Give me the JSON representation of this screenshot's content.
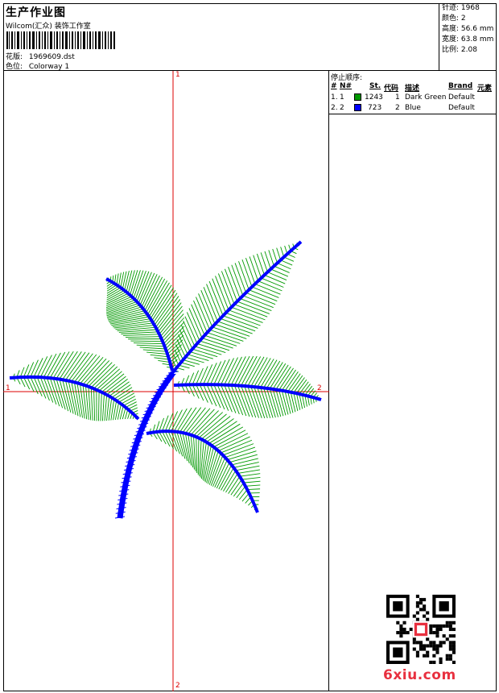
{
  "header": {
    "title": "生产作业图",
    "subtitle": "Wilcom(汇众) 装饰工作室",
    "design_label": "花版:",
    "design_value": "1969609.dst",
    "colorway_label": "色位:",
    "colorway_value": "Colorway 1"
  },
  "specs": [
    {
      "label": "针迹:",
      "value": "1968"
    },
    {
      "label": "颜色:",
      "value": "2"
    },
    {
      "label": "高度:",
      "value": "56.6 mm"
    },
    {
      "label": "宽度:",
      "value": "63.8 mm"
    },
    {
      "label": "比例:",
      "value": "2.08"
    }
  ],
  "stop_sequence": {
    "title": "停止顺序:",
    "columns": [
      "#",
      "N#",
      "St.",
      "代码",
      "描述",
      "Brand",
      "元素"
    ],
    "rows": [
      {
        "idx": "1.",
        "n": "1",
        "color": "#009900",
        "stitches": "1243",
        "code": "1",
        "desc": "Dark Green",
        "brand": "Default"
      },
      {
        "idx": "2.",
        "n": "2",
        "color": "#0000ff",
        "stitches": "723",
        "code": "2",
        "desc": "Blue",
        "brand": "Default"
      }
    ]
  },
  "axes": {
    "v_top": "1",
    "v_bottom": "2",
    "h_left": "1",
    "h_right": "2"
  },
  "watermark": "6xiu.com",
  "colors": {
    "leaf": "#009900",
    "vein": "#0000ff",
    "axis": "#dd0000"
  }
}
